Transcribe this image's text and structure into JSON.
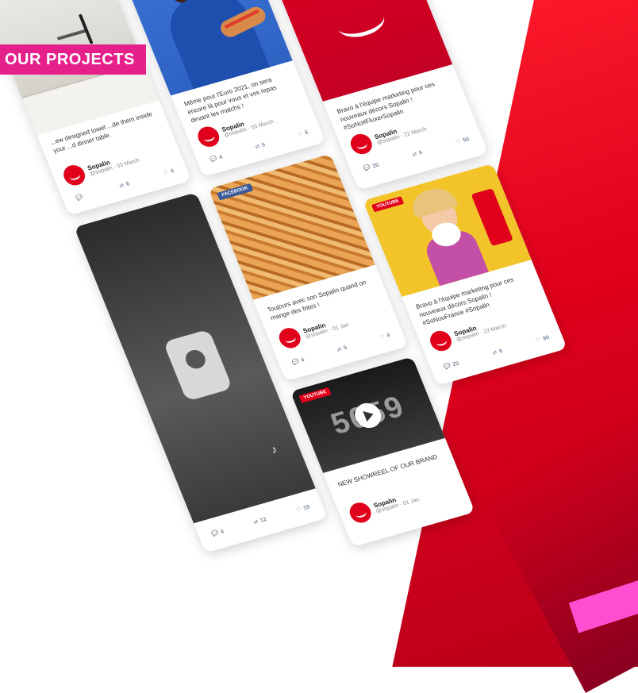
{
  "header": {
    "tag": "OUR PROJECTS"
  },
  "colors": {
    "brand_red": "#e0001b",
    "tag_pink": "#e6208a",
    "pink_accent": "#ff4fd0"
  },
  "posts": [
    {
      "id": "kitchen",
      "text": "...ew designed towel ...de them inside your ...d dinner table.",
      "author": "Sopalin",
      "meta": "@sopalin · 03 March",
      "replies": "",
      "retweets": "6",
      "likes": "4"
    },
    {
      "id": "hotdog",
      "text": "Même pour l'Euro 2021, on sera encore là pour vous et vos repas devant les matchs !",
      "author": "Sopalin",
      "meta": "@sopalin · 03 March",
      "replies": "4",
      "retweets": "5",
      "likes": "6"
    },
    {
      "id": "sopalin-red",
      "text": "Bravo à l'équipe marketing pour ces nouveaux décors Sopalin ! #SoNo#FluxerSopalin",
      "author": "Sopalin",
      "meta": "@sopalin · 22 March",
      "replies": "20",
      "retweets": "6",
      "likes": "50"
    },
    {
      "id": "fries",
      "badge": "FACEBOOK",
      "text": "Toujours avec son Sopalin quand on mange des frites !",
      "author": "Sopalin",
      "meta": "@sopalin · 01 Jan",
      "replies": "4",
      "retweets": "5",
      "likes": "4"
    },
    {
      "id": "girl",
      "badge": "YOUTUBE",
      "text": "Bravo à l'équipe marketing pour ces nouveaux décors Sopalin ! #SoNouFrance #Sopalin",
      "author": "Sopalin",
      "meta": "@sopalin · 23 March",
      "replies": "25",
      "retweets": "6",
      "likes": "90"
    },
    {
      "id": "tiktok",
      "replies": "4",
      "retweets": "12",
      "likes": "19"
    },
    {
      "id": "video",
      "badge": "YOUTUBE",
      "video_number": "5059",
      "text": "NEW SHOWREEL OF OUR BRAND",
      "author": "Sopalin",
      "meta": "@sopalin · 01 Jan"
    }
  ],
  "icons": {
    "reply": "chat-bubble-icon",
    "retweet": "retweet-icon",
    "like": "heart-icon",
    "play": "play-icon",
    "logo": "sopalin-smile-logo"
  }
}
